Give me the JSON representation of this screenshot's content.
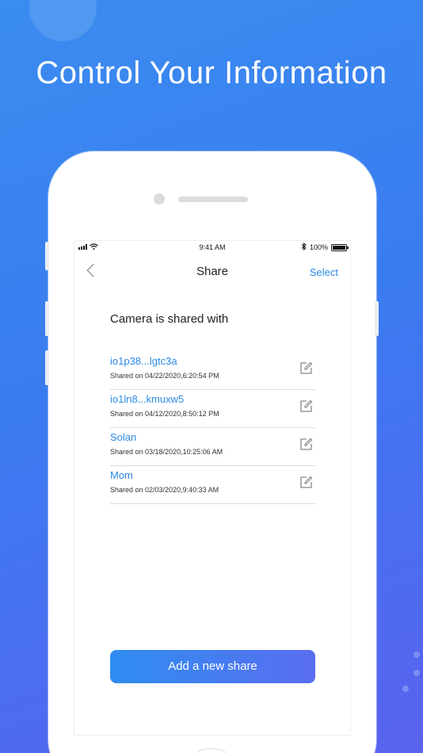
{
  "headline": "Control Your Information",
  "status_bar": {
    "time": "9:41 AM",
    "battery_pct": "100%",
    "bluetooth_icon": "bluetooth-icon",
    "wifi_icon": "wifi-icon",
    "signal_icon": "signal-icon"
  },
  "nav": {
    "title": "Share",
    "select_label": "Select",
    "back_icon": "chevron-left-icon"
  },
  "section_title": "Camera is shared with",
  "shares": [
    {
      "name": "io1p38...lgtc3a",
      "date": "Shared on 04/22/2020,6:20:54 PM"
    },
    {
      "name": "io1ln8...kmuxw5",
      "date": "Shared on 04/12/2020,8:50:12 PM"
    },
    {
      "name": "Solan",
      "date": "Shared on 03/18/2020,10:25:06 AM"
    },
    {
      "name": "Mom",
      "date": "Shared on 02/03/2020,9:40:33 AM"
    }
  ],
  "add_button_label": "Add a new share",
  "colors": {
    "accent": "#2b8ae6",
    "background_start": "#3a8cf0",
    "background_end": "#5a62ee"
  }
}
